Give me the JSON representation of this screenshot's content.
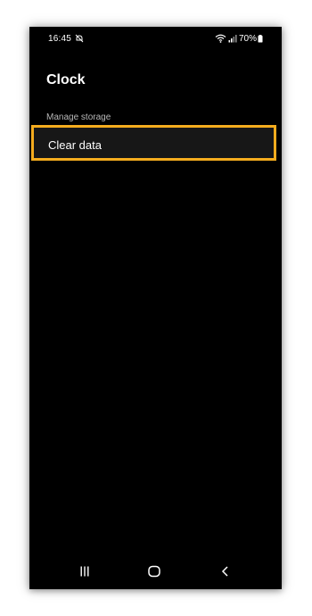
{
  "status_bar": {
    "time": "16:45",
    "battery_percent": "70%",
    "icons": [
      "mute-icon",
      "wifi-icon",
      "signal-icon",
      "battery-icon"
    ]
  },
  "header": {
    "title": "Clock"
  },
  "section": {
    "label": "Manage storage"
  },
  "rows": [
    {
      "label": "Clear data",
      "highlighted": true
    }
  ],
  "nav_bar": {
    "buttons": [
      "recents-icon",
      "home-icon",
      "back-icon"
    ]
  },
  "colors": {
    "background": "#000000",
    "highlight_border": "#f4ac1e",
    "row_background": "#171717",
    "section_label": "#b8b8b8"
  }
}
